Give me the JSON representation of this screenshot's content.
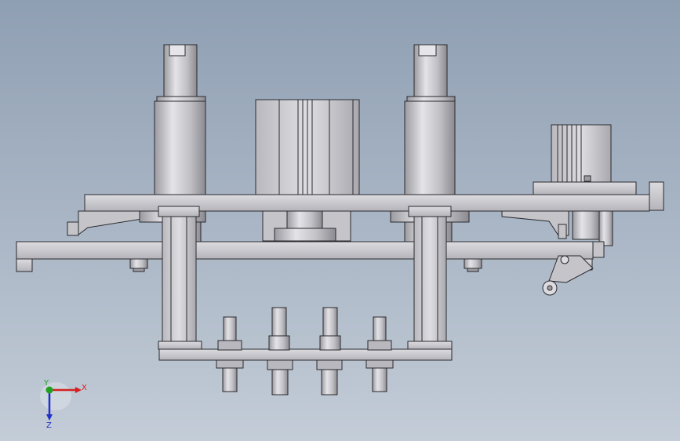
{
  "viewport": {
    "background_top": "#8f9fb3",
    "background_bottom": "#c3ccd7"
  },
  "model": {
    "part_fill": "#cfcfd3",
    "part_shade": "#9c9ca2",
    "edge_color": "#2a2a2e"
  },
  "triad": {
    "x_label": "X",
    "y_label": "Y",
    "z_label": "Z",
    "x_color": "#d42020",
    "y_color": "#1fa01f",
    "z_color": "#2030c8"
  }
}
